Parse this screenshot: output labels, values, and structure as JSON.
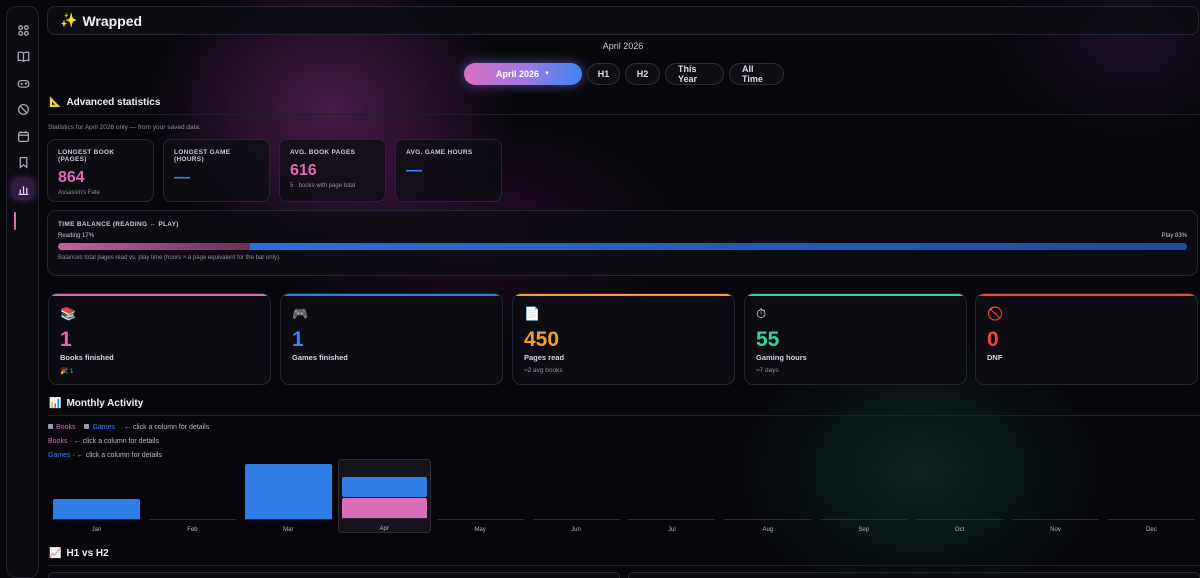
{
  "header": {
    "title": "Wrapped",
    "icon": "sparkles-icon"
  },
  "period_label": "April 2026",
  "tabs": [
    {
      "label": "April 2026",
      "active": true
    },
    {
      "label": "H1",
      "active": false
    },
    {
      "label": "H2",
      "active": false
    },
    {
      "label": "This Year",
      "active": false
    },
    {
      "label": "All Time",
      "active": false
    }
  ],
  "advanced": {
    "title": "Advanced statistics",
    "note": "Statistics for April 2026 only — from your saved data.",
    "cards": [
      {
        "label": "LONGEST BOOK (PAGES)",
        "value": "864",
        "sub": "Assassin's Fate"
      },
      {
        "label": "LONGEST GAME (HOURS)",
        "value": "—",
        "sub": ""
      },
      {
        "label": "AVG. BOOK PAGES",
        "value": "616",
        "sub": "5 · books with page total"
      },
      {
        "label": "AVG. GAME HOURS",
        "value": "—",
        "sub": ""
      }
    ]
  },
  "balance": {
    "label": "TIME BALANCE (READING ↔ PLAY)",
    "reading_label": "Reading 17%",
    "play_label": "Play 83%",
    "reading_fraction": 0.17,
    "note": "Balances total pages read vs. play time (hours × a page equivalent for the bar only)."
  },
  "summary": [
    {
      "emoji": "📚",
      "value": "1",
      "label": "Books finished",
      "sub": "🎉 1"
    },
    {
      "emoji": "🎮",
      "value": "1",
      "label": "Games finished",
      "sub": ""
    },
    {
      "emoji": "📄",
      "value": "450",
      "label": "Pages read",
      "sub": "≈2 avg books"
    },
    {
      "emoji": "⏱",
      "value": "55",
      "label": "Gaming hours",
      "sub": "≈7 days"
    },
    {
      "emoji": "🚫",
      "value": "0",
      "label": "DNF",
      "sub": ""
    }
  ],
  "monthly": {
    "title": "Monthly Activity",
    "legend_books": "Books",
    "legend_games": "Games",
    "legend_hint": "← click a column for details",
    "books_hint_name": "Books",
    "books_hint": " · ← click a column for details",
    "games_hint_name": "Games",
    "games_hint": " · ← click a column for details",
    "selected_month": "Apr"
  },
  "h1h2": {
    "title": "H1 vs H2"
  },
  "colors": {
    "books": "#d86fb6",
    "games": "#2f7ee8",
    "accent": "#e06bb6"
  },
  "chart_data": {
    "type": "bar",
    "stacked": true,
    "categories": [
      "Jan",
      "Feb",
      "Mar",
      "Apr",
      "May",
      "Jun",
      "Jul",
      "Aug",
      "Sep",
      "Oct",
      "Nov",
      "Dec"
    ],
    "series": [
      {
        "name": "Books",
        "values": [
          0,
          0,
          0,
          0.37,
          0,
          0,
          0,
          0,
          0,
          0,
          0,
          0
        ]
      },
      {
        "name": "Games",
        "values": [
          0.37,
          0,
          1.0,
          0.37,
          0,
          0,
          0,
          0,
          0,
          0,
          0,
          0
        ]
      }
    ],
    "ylim": [
      0,
      1
    ]
  }
}
